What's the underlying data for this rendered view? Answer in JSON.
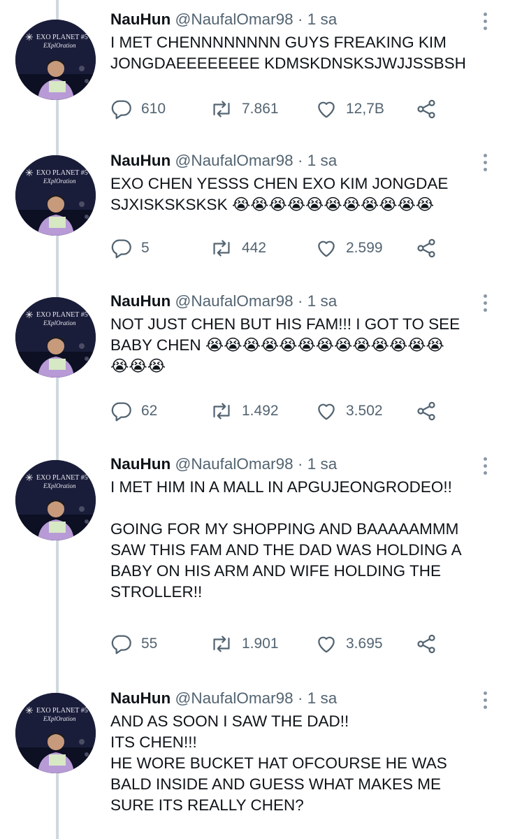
{
  "tweets": [
    {
      "name": "NauHun",
      "handle": "@NaufalOmar98",
      "sep": "·",
      "time": "1 sa",
      "text": "I MET CHENNNNNNNN GUYS FREAKING KIM\nJONGDAEEEEEEEE KDMSKDNSKSJWJJSSBSH",
      "replies": "610",
      "retweets": "7.861",
      "likes": "12,7B"
    },
    {
      "name": "NauHun",
      "handle": "@NaufalOmar98",
      "sep": "·",
      "time": "1 sa",
      "text": "EXO CHEN YESSS CHEN EXO KIM JONGDAE\nSJXISKSKSKSK 😭😭😭😭😭😭😭😭😭😭😭",
      "replies": "5",
      "retweets": "442",
      "likes": "2.599"
    },
    {
      "name": "NauHun",
      "handle": "@NaufalOmar98",
      "sep": "·",
      "time": "1 sa",
      "text": "NOT JUST CHEN BUT HIS FAM!!! I GOT TO SEE\nBABY CHEN 😭😭😭😭😭😭😭😭😭😭😭😭😭\n😭😭😭",
      "replies": "62",
      "retweets": "1.492",
      "likes": "3.502"
    },
    {
      "name": "NauHun",
      "handle": "@NaufalOmar98",
      "sep": "·",
      "time": "1 sa",
      "text": "I MET HIM IN A MALL IN APGUJEONGRODEO!!\n\nGOING FOR MY SHOPPING AND BAAAAAMMM\nSAW THIS FAM AND THE DAD WAS HOLDING A\nBABY ON HIS ARM AND WIFE HOLDING THE\nSTROLLER!!",
      "replies": "55",
      "retweets": "1.901",
      "likes": "3.695"
    },
    {
      "name": "NauHun",
      "handle": "@NaufalOmar98",
      "sep": "·",
      "time": "1 sa",
      "text": "AND AS SOON I SAW THE DAD!!\nITS CHEN!!!\nHE WORE BUCKET HAT OFCOURSE HE WAS\nBALD INSIDE AND GUESS WHAT MAKES ME\nSURE ITS REALLY CHEN?"
    }
  ],
  "avatar_text": {
    "line1": "EXO PLANET #5",
    "line2": "EXplOration"
  },
  "colors": {
    "text": "#0f1419",
    "muted": "#536471",
    "thread_line": "#cfd9de",
    "avatar_bg": "#1a1d3a"
  },
  "icons": [
    "reply-icon",
    "retweet-icon",
    "like-icon",
    "share-icon",
    "more-options-icon"
  ]
}
